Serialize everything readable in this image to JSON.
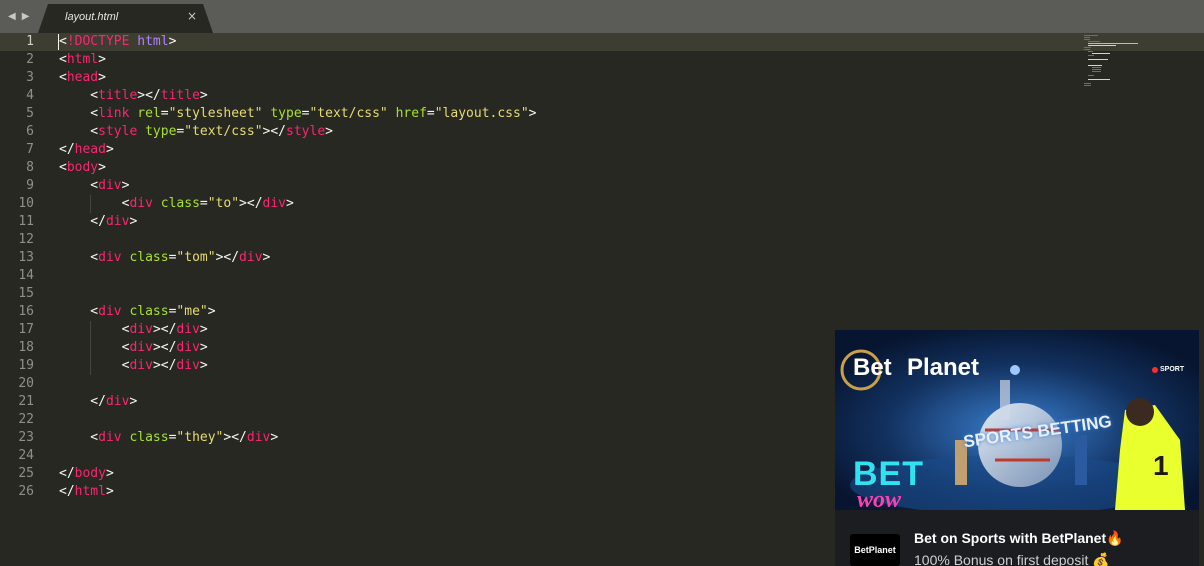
{
  "tab": {
    "label": "layout.html",
    "close_glyph": "×",
    "back_glyph": "◀",
    "forward_glyph": "▶"
  },
  "editor": {
    "active_line": 1,
    "lines": [
      [
        {
          "t": "<",
          "c": "pu"
        },
        {
          "t": "!DOCTYPE",
          "c": "tg"
        },
        {
          "t": " ",
          "c": "pu"
        },
        {
          "t": "html",
          "c": "dt"
        },
        {
          "t": ">",
          "c": "pu"
        }
      ],
      [
        {
          "t": "<",
          "c": "pu"
        },
        {
          "t": "html",
          "c": "tg"
        },
        {
          "t": ">",
          "c": "pu"
        }
      ],
      [
        {
          "t": "<",
          "c": "pu"
        },
        {
          "t": "head",
          "c": "tg"
        },
        {
          "t": ">",
          "c": "pu"
        }
      ],
      [
        {
          "t": "    <",
          "c": "pu"
        },
        {
          "t": "title",
          "c": "tg"
        },
        {
          "t": "></",
          "c": "pu"
        },
        {
          "t": "title",
          "c": "tg"
        },
        {
          "t": ">",
          "c": "pu"
        }
      ],
      [
        {
          "t": "    <",
          "c": "pu"
        },
        {
          "t": "link",
          "c": "tg"
        },
        {
          "t": " ",
          "c": "pu"
        },
        {
          "t": "rel",
          "c": "at"
        },
        {
          "t": "=",
          "c": "pu"
        },
        {
          "t": "\"stylesheet\"",
          "c": "st"
        },
        {
          "t": " ",
          "c": "pu"
        },
        {
          "t": "type",
          "c": "at"
        },
        {
          "t": "=",
          "c": "pu"
        },
        {
          "t": "\"text/css\"",
          "c": "st"
        },
        {
          "t": " ",
          "c": "pu"
        },
        {
          "t": "href",
          "c": "at"
        },
        {
          "t": "=",
          "c": "pu"
        },
        {
          "t": "\"layout.css\"",
          "c": "st"
        },
        {
          "t": ">",
          "c": "pu"
        }
      ],
      [
        {
          "t": "    <",
          "c": "pu"
        },
        {
          "t": "style",
          "c": "tg"
        },
        {
          "t": " ",
          "c": "pu"
        },
        {
          "t": "type",
          "c": "at"
        },
        {
          "t": "=",
          "c": "pu"
        },
        {
          "t": "\"text/css\"",
          "c": "st"
        },
        {
          "t": "></",
          "c": "pu"
        },
        {
          "t": "style",
          "c": "tg"
        },
        {
          "t": ">",
          "c": "pu"
        }
      ],
      [
        {
          "t": "</",
          "c": "pu"
        },
        {
          "t": "head",
          "c": "tg"
        },
        {
          "t": ">",
          "c": "pu"
        }
      ],
      [
        {
          "t": "<",
          "c": "pu"
        },
        {
          "t": "body",
          "c": "tg"
        },
        {
          "t": ">",
          "c": "pu"
        }
      ],
      [
        {
          "t": "    <",
          "c": "pu"
        },
        {
          "t": "div",
          "c": "tg"
        },
        {
          "t": ">",
          "c": "pu"
        }
      ],
      [
        {
          "t": "        <",
          "c": "pu"
        },
        {
          "t": "div",
          "c": "tg"
        },
        {
          "t": " ",
          "c": "pu"
        },
        {
          "t": "class",
          "c": "at"
        },
        {
          "t": "=",
          "c": "pu"
        },
        {
          "t": "\"to\"",
          "c": "st"
        },
        {
          "t": "></",
          "c": "pu"
        },
        {
          "t": "div",
          "c": "tg"
        },
        {
          "t": ">",
          "c": "pu"
        }
      ],
      [
        {
          "t": "    </",
          "c": "pu"
        },
        {
          "t": "div",
          "c": "tg"
        },
        {
          "t": ">",
          "c": "pu"
        }
      ],
      [],
      [
        {
          "t": "    <",
          "c": "pu"
        },
        {
          "t": "div",
          "c": "tg"
        },
        {
          "t": " ",
          "c": "pu"
        },
        {
          "t": "class",
          "c": "at"
        },
        {
          "t": "=",
          "c": "pu"
        },
        {
          "t": "\"tom\"",
          "c": "st"
        },
        {
          "t": "></",
          "c": "pu"
        },
        {
          "t": "div",
          "c": "tg"
        },
        {
          "t": ">",
          "c": "pu"
        }
      ],
      [],
      [],
      [
        {
          "t": "    <",
          "c": "pu"
        },
        {
          "t": "div",
          "c": "tg"
        },
        {
          "t": " ",
          "c": "pu"
        },
        {
          "t": "class",
          "c": "at"
        },
        {
          "t": "=",
          "c": "pu"
        },
        {
          "t": "\"me\"",
          "c": "st"
        },
        {
          "t": ">",
          "c": "pu"
        }
      ],
      [
        {
          "t": "        <",
          "c": "pu"
        },
        {
          "t": "div",
          "c": "tg"
        },
        {
          "t": "></",
          "c": "pu"
        },
        {
          "t": "div",
          "c": "tg"
        },
        {
          "t": ">",
          "c": "pu"
        }
      ],
      [
        {
          "t": "        <",
          "c": "pu"
        },
        {
          "t": "div",
          "c": "tg"
        },
        {
          "t": "></",
          "c": "pu"
        },
        {
          "t": "div",
          "c": "tg"
        },
        {
          "t": ">",
          "c": "pu"
        }
      ],
      [
        {
          "t": "        <",
          "c": "pu"
        },
        {
          "t": "div",
          "c": "tg"
        },
        {
          "t": "></",
          "c": "pu"
        },
        {
          "t": "div",
          "c": "tg"
        },
        {
          "t": ">",
          "c": "pu"
        }
      ],
      [],
      [
        {
          "t": "    </",
          "c": "pu"
        },
        {
          "t": "div",
          "c": "tg"
        },
        {
          "t": ">",
          "c": "pu"
        }
      ],
      [],
      [
        {
          "t": "    <",
          "c": "pu"
        },
        {
          "t": "div",
          "c": "tg"
        },
        {
          "t": " ",
          "c": "pu"
        },
        {
          "t": "class",
          "c": "at"
        },
        {
          "t": "=",
          "c": "pu"
        },
        {
          "t": "\"they\"",
          "c": "st"
        },
        {
          "t": "></",
          "c": "pu"
        },
        {
          "t": "div",
          "c": "tg"
        },
        {
          "t": ">",
          "c": "pu"
        }
      ],
      [],
      [
        {
          "t": "</",
          "c": "pu"
        },
        {
          "t": "body",
          "c": "tg"
        },
        {
          "t": ">",
          "c": "pu"
        }
      ],
      [
        {
          "t": "</",
          "c": "pu"
        },
        {
          "t": "html",
          "c": "tg"
        },
        {
          "t": ">",
          "c": "pu"
        }
      ]
    ]
  },
  "ad": {
    "brand_bet": "Bet",
    "brand_planet": "Planet",
    "sport_tag": "SPORT",
    "hero_text": "SPORTS BETTING",
    "neon_text": "BET",
    "neon_text_2": "wow",
    "small_logo": "BetPlanet",
    "title": "Bet on Sports with BetPlanet🔥",
    "subtitle": "100%  Bonus on first deposit 💰"
  },
  "colors": {
    "background": "#272822",
    "tag": "#f92672",
    "attribute": "#a6e22e",
    "string": "#e6db74",
    "doctype_keyword": "#ae81ff",
    "punctuation": "#f8f8f2",
    "line_number": "#8f908a",
    "active_line": "#3e3d32",
    "tab_bar": "#5b5b57"
  }
}
